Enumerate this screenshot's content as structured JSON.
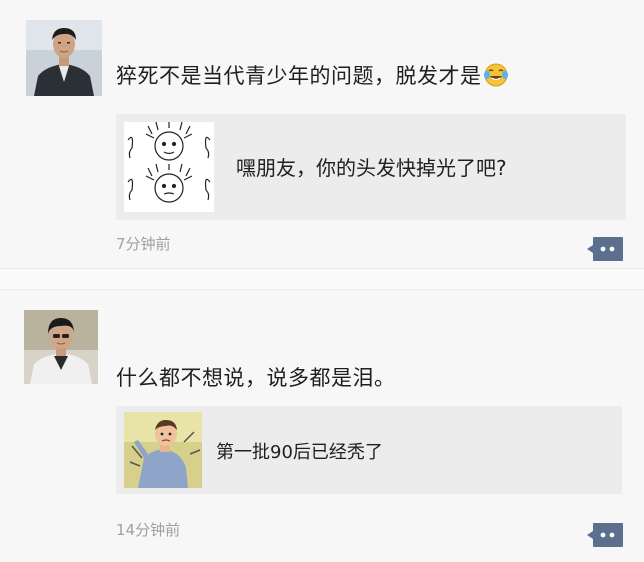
{
  "posts": [
    {
      "text": "猝死不是当代青少年的问题，脱发才是",
      "emoji": "crying-laughing-emoji-icon",
      "shared_link": {
        "title": "嘿朋友，你的头发快掉光了吧?"
      },
      "time": "7分钟前"
    },
    {
      "text": "什么都不想说，说多都是泪。",
      "shared_link": {
        "title": "第一批90后已经秃了"
      },
      "time": "14分钟前"
    }
  ],
  "colors": {
    "background": "#f7f7f7",
    "card": "#ececec",
    "timestamp": "#a0a0a0",
    "comment_button": "#5b6f8f"
  }
}
